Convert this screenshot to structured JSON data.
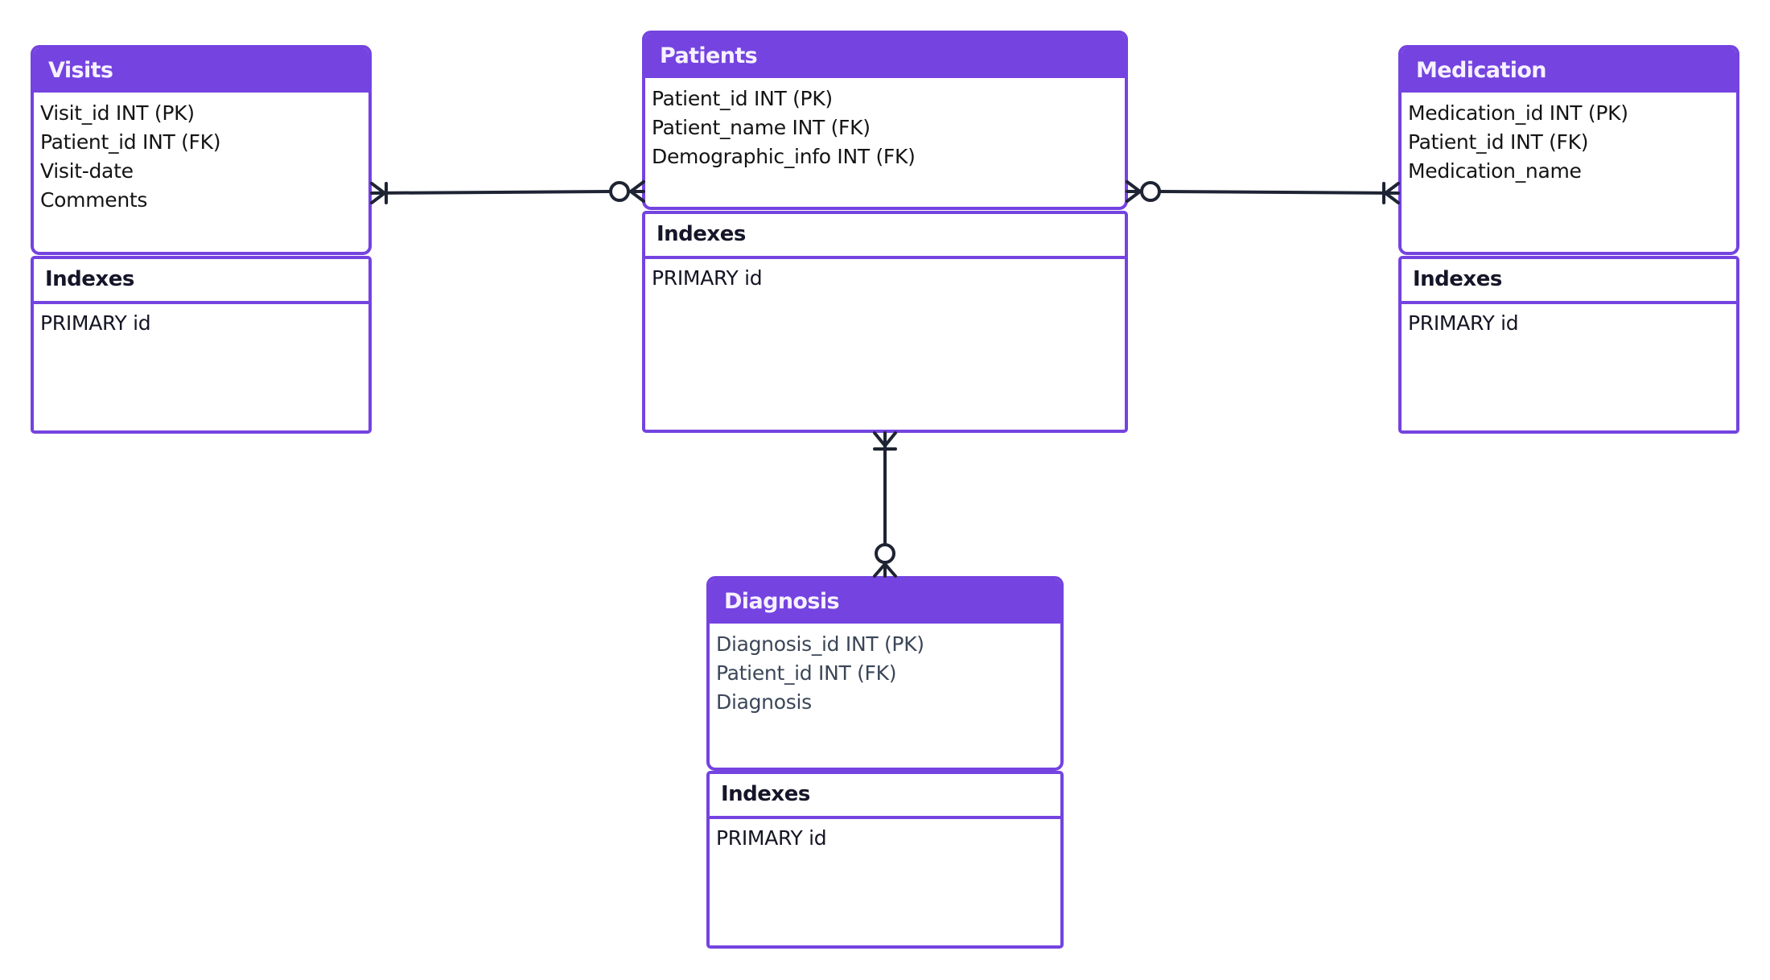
{
  "diagram": {
    "type": "entity-relationship",
    "colors": {
      "entity_header": "#7443e0",
      "entity_border": "#7443e0",
      "connector": "#1e2433",
      "header_text": "#f6f1ff"
    },
    "entities": {
      "visits": {
        "title": "Visits",
        "fields": [
          "Visit_id INT (PK)",
          "Patient_id INT (FK)",
          "Visit-date",
          "Comments"
        ],
        "indexes_label": "Indexes",
        "indexes": [
          "PRIMARY id"
        ]
      },
      "patients": {
        "title": "Patients",
        "fields": [
          "Patient_id INT (PK)",
          "Patient_name INT (FK)",
          "Demographic_info INT (FK)"
        ],
        "indexes_label": "Indexes",
        "indexes": [
          "PRIMARY id"
        ]
      },
      "medication": {
        "title": "Medication",
        "fields": [
          "Medication_id INT (PK)",
          "Patient_id INT (FK)",
          "Medication_name"
        ],
        "indexes_label": "Indexes",
        "indexes": [
          "PRIMARY id"
        ]
      },
      "diagnosis": {
        "title": "Diagnosis",
        "fields": [
          "Diagnosis_id INT (PK)",
          "Patient_id INT (FK)",
          "Diagnosis"
        ],
        "indexes_label": "Indexes",
        "indexes": [
          "PRIMARY id"
        ]
      }
    },
    "relationships": [
      {
        "from": "Patients",
        "to": "Visits",
        "from_cardinality": "zero-or-many",
        "to_cardinality": "one-or-many"
      },
      {
        "from": "Patients",
        "to": "Medication",
        "from_cardinality": "zero-or-many",
        "to_cardinality": "one-or-many"
      },
      {
        "from": "Patients",
        "to": "Diagnosis",
        "from_cardinality": "one-or-many",
        "to_cardinality": "zero-or-many"
      }
    ]
  }
}
